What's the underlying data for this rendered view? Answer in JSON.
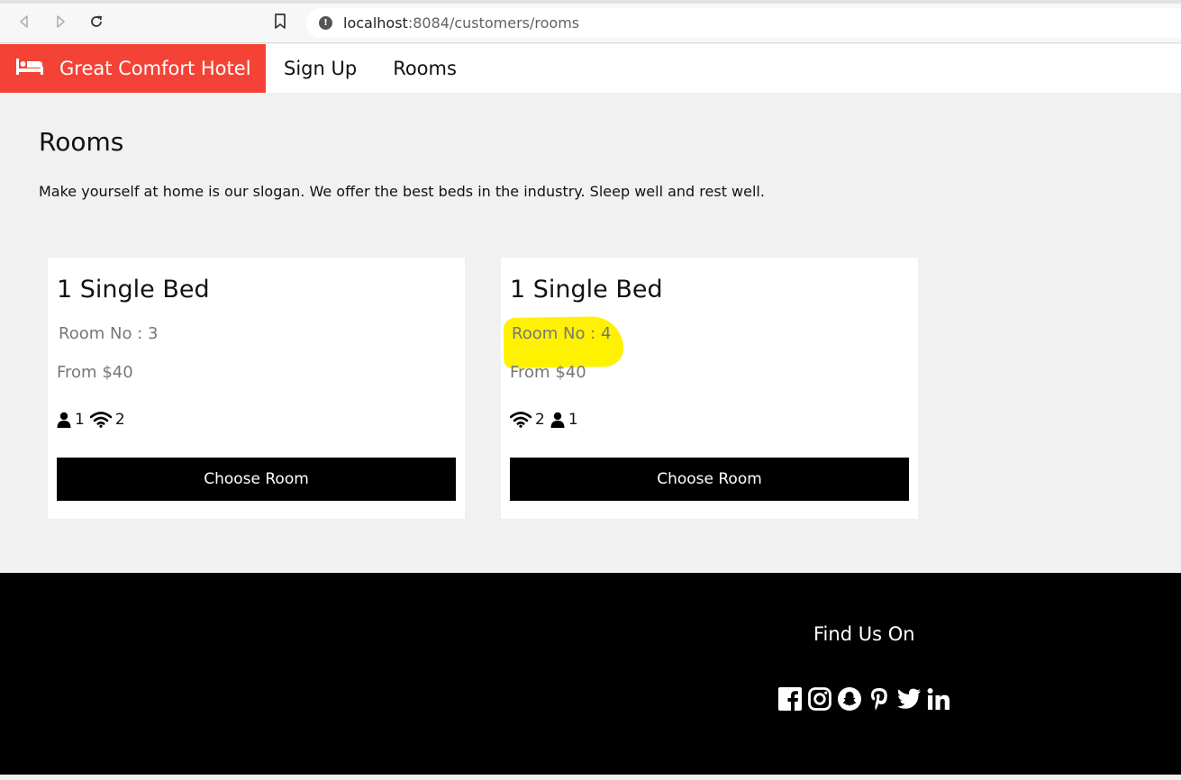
{
  "browser": {
    "url_host": "localhost",
    "url_rest": ":8084/customers/rooms"
  },
  "navbar": {
    "brand_label": "Great Comfort Hotel",
    "links": [
      {
        "label": "Sign Up"
      },
      {
        "label": "Rooms"
      }
    ]
  },
  "main": {
    "title": "Rooms",
    "slogan": "Make yourself at home is our slogan. We offer the best beds in the industry. Sleep well and rest well."
  },
  "rooms": [
    {
      "title": "1 Single Bed",
      "room_no": "Room No : 3",
      "price": "From $40",
      "features": [
        {
          "icon": "user-icon",
          "count": "1"
        },
        {
          "icon": "wifi-icon",
          "count": "2"
        }
      ],
      "button_label": "Choose Room"
    },
    {
      "title": "1 Single Bed",
      "room_no": "Room No : 4",
      "price": "From $40",
      "features": [
        {
          "icon": "wifi-icon",
          "count": "2"
        },
        {
          "icon": "user-icon",
          "count": "1"
        }
      ],
      "button_label": "Choose Room",
      "highlighted": true
    }
  ],
  "footer": {
    "title": "Find Us On",
    "social": [
      "facebook-icon",
      "instagram-icon",
      "snapchat-icon",
      "pinterest-icon",
      "twitter-icon",
      "linkedin-icon"
    ]
  },
  "colors": {
    "brand": "#f44336",
    "highlight": "#fff200",
    "button": "#000000",
    "footer": "#000000"
  }
}
